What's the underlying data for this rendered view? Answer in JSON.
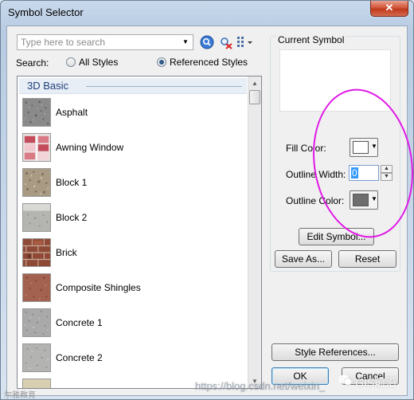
{
  "window": {
    "title": "Symbol Selector",
    "close_glyph": "✕"
  },
  "search": {
    "placeholder": "Type here to search",
    "label": "Search:",
    "options": [
      {
        "label": "All Styles",
        "checked": false
      },
      {
        "label": "Referenced Styles",
        "checked": true
      }
    ]
  },
  "symbol_list": {
    "group": "3D Basic",
    "items": [
      {
        "label": "Asphalt",
        "texture": "asphalt"
      },
      {
        "label": "Awning Window",
        "texture": "awning"
      },
      {
        "label": "Block 1",
        "texture": "block1"
      },
      {
        "label": "Block 2",
        "texture": "block2"
      },
      {
        "label": "Brick",
        "texture": "brick"
      },
      {
        "label": "Composite Shingles",
        "texture": "shingles"
      },
      {
        "label": "Concrete 1",
        "texture": "concrete1"
      },
      {
        "label": "Concrete 2",
        "texture": "concrete2"
      }
    ]
  },
  "current_symbol": {
    "group_label": "Current Symbol",
    "fill_color_label": "Fill Color:",
    "fill_color": "#ffffff",
    "outline_width_label": "Outline Width:",
    "outline_width_value": "0",
    "outline_color_label": "Outline Color:",
    "outline_color": "#6e6e6e",
    "edit_symbol_label": "Edit Symbol...",
    "save_as_label": "Save As...",
    "reset_label": "Reset"
  },
  "bottom": {
    "style_references_label": "Style References...",
    "ok_label": "OK",
    "cancel_label": "Cancel"
  },
  "watermarks": {
    "url": "https://blog.csdn.net/weixin_",
    "brand": "GIS前沿",
    "corner": "尔雅教育"
  },
  "colors": {
    "annotation": "#e019e6",
    "group_header_text": "#1e3e78"
  }
}
